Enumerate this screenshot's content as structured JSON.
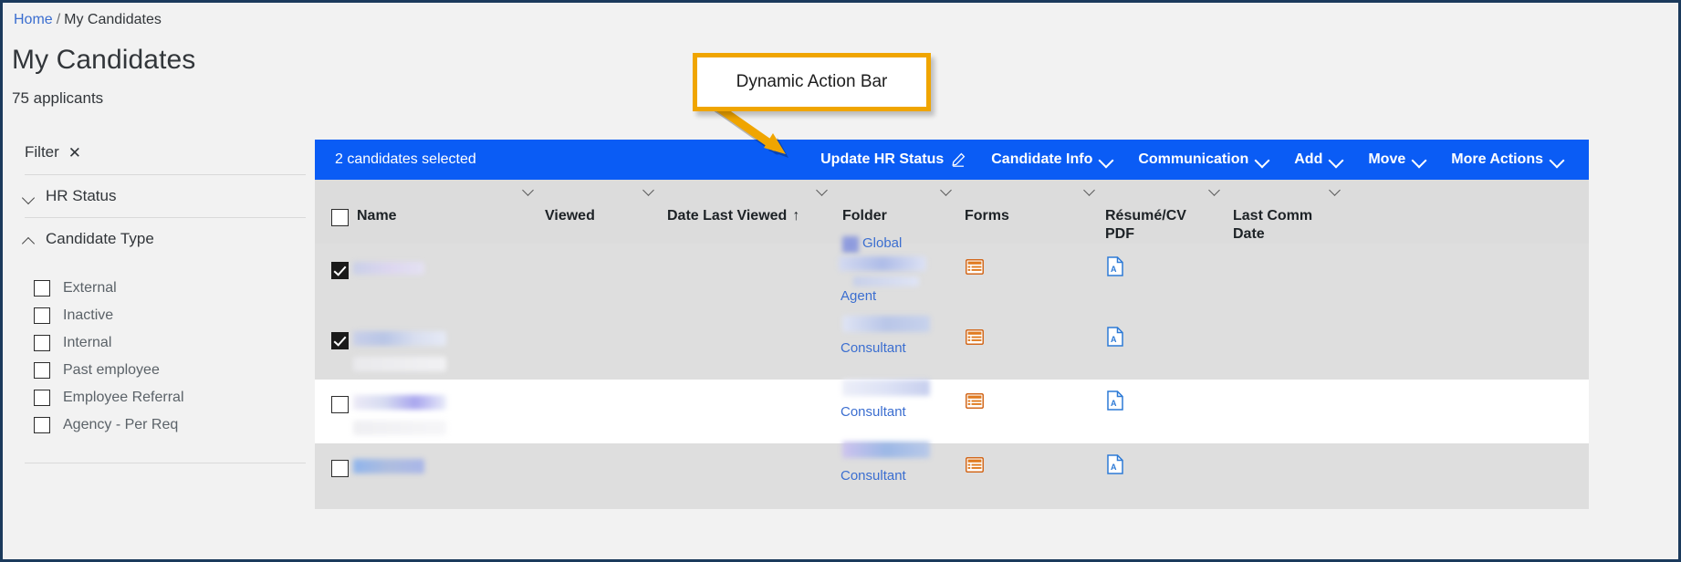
{
  "breadcrumb": {
    "home": "Home",
    "separator": "/",
    "current": "My Candidates"
  },
  "page": {
    "title": "My Candidates",
    "subtitle": "75 applicants"
  },
  "sidebar": {
    "filter_label": "Filter",
    "close_icon": "close-icon",
    "facets": [
      {
        "label": "HR Status",
        "expanded": false
      },
      {
        "label": "Candidate Type",
        "expanded": true
      }
    ],
    "candidate_type_options": [
      {
        "label": "External",
        "checked": false
      },
      {
        "label": "Inactive",
        "checked": false
      },
      {
        "label": "Internal",
        "checked": false
      },
      {
        "label": "Past employee",
        "checked": false
      },
      {
        "label": "Employee Referral",
        "checked": false
      },
      {
        "label": "Agency - Per Req",
        "checked": false
      }
    ]
  },
  "action_bar": {
    "selection_text": "2 candidates selected",
    "background_color": "#0a5cf5",
    "actions": [
      {
        "label": "Update HR Status",
        "icon": "pencil-icon"
      },
      {
        "label": "Candidate Info",
        "icon": "chevron-down-icon"
      },
      {
        "label": "Communication",
        "icon": "chevron-down-icon"
      },
      {
        "label": "Add",
        "icon": "chevron-down-icon"
      },
      {
        "label": "Move",
        "icon": "chevron-down-icon"
      },
      {
        "label": "More Actions",
        "icon": "chevron-down-icon"
      }
    ]
  },
  "table": {
    "columns": [
      {
        "label": "Name",
        "sorted": false
      },
      {
        "label": "Viewed",
        "sorted": false
      },
      {
        "label": "Date Last Viewed",
        "sorted": true,
        "sort_direction": "↑"
      },
      {
        "label": "Folder",
        "sorted": false
      },
      {
        "label": "Forms",
        "sorted": false
      },
      {
        "label": "Résumé/CV PDF",
        "sorted": false
      },
      {
        "label": "Last Comm Date",
        "sorted": false
      }
    ],
    "rows": [
      {
        "selected": true,
        "shade": "grey",
        "folder_primary": "Global",
        "folder_secondary": "Agent",
        "forms_icon": "forms-icon",
        "pdf_icon": "pdf-icon"
      },
      {
        "selected": true,
        "shade": "grey",
        "folder_primary": "",
        "folder_secondary": "Consultant",
        "forms_icon": "forms-icon",
        "pdf_icon": "pdf-icon"
      },
      {
        "selected": false,
        "shade": "white",
        "folder_primary": "",
        "folder_secondary": "Consultant",
        "forms_icon": "forms-icon",
        "pdf_icon": "pdf-icon"
      },
      {
        "selected": false,
        "shade": "grey",
        "folder_primary": "",
        "folder_secondary": "Consultant",
        "forms_icon": "forms-icon",
        "pdf_icon": "pdf-icon"
      }
    ]
  },
  "callout": {
    "text": "Dynamic Action Bar",
    "border_color": "#f0a500",
    "arrow_color": "#f0a500"
  }
}
